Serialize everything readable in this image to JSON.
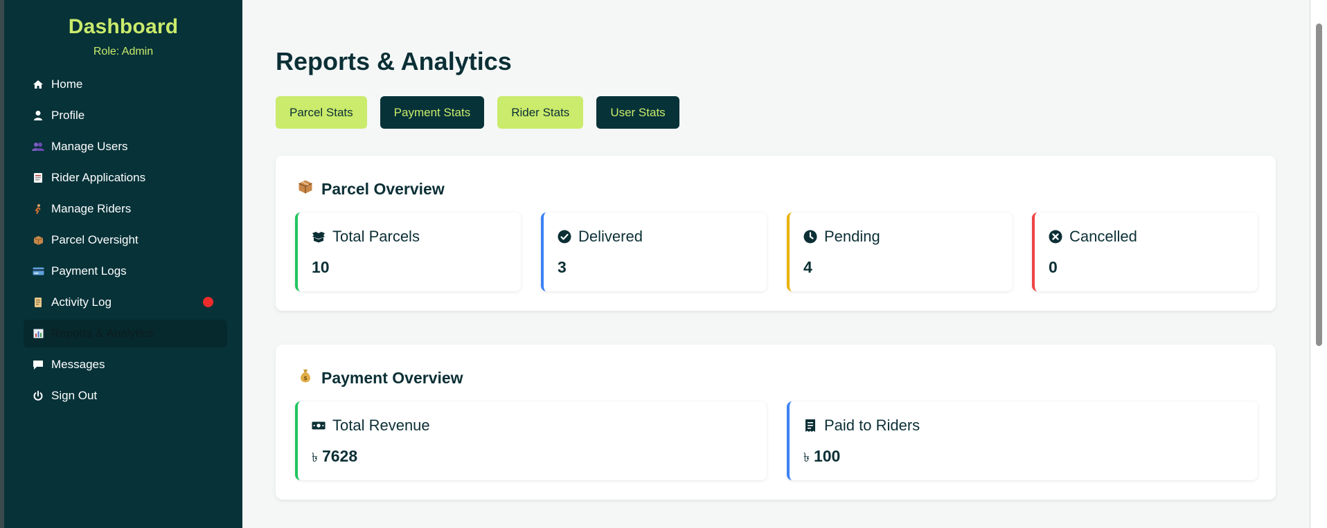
{
  "sidebar": {
    "title": "Dashboard",
    "role": "Role: Admin",
    "items": [
      {
        "label": "Home",
        "icon": "home-icon"
      },
      {
        "label": "Profile",
        "icon": "user-icon"
      },
      {
        "label": "Manage Users",
        "icon": "users-icon"
      },
      {
        "label": "Rider Applications",
        "icon": "document-icon"
      },
      {
        "label": "Manage Riders",
        "icon": "rider-icon"
      },
      {
        "label": "Parcel Oversight",
        "icon": "package-icon"
      },
      {
        "label": "Payment Logs",
        "icon": "credit-card-icon"
      },
      {
        "label": "Activity Log",
        "icon": "scroll-icon"
      },
      {
        "label": "Reports & Analytics",
        "icon": "bar-chart-icon"
      },
      {
        "label": "Messages",
        "icon": "message-icon"
      },
      {
        "label": "Sign Out",
        "icon": "power-icon"
      }
    ],
    "active_item": "Reports & Analytics"
  },
  "main": {
    "title": "Reports & Analytics",
    "tabs": [
      {
        "label": "Parcel Stats",
        "style": "light"
      },
      {
        "label": "Payment Stats",
        "style": "dark"
      },
      {
        "label": "Rider Stats",
        "style": "light"
      },
      {
        "label": "User Stats",
        "style": "dark"
      }
    ],
    "parcel_overview": {
      "title": "Parcel Overview",
      "icon": "package-icon",
      "cards": [
        {
          "label": "Total Parcels",
          "value": "10",
          "icon": "boxes-icon",
          "color": "#22c55e"
        },
        {
          "label": "Delivered",
          "value": "3",
          "icon": "check-circle-icon",
          "color": "#3b82f6"
        },
        {
          "label": "Pending",
          "value": "4",
          "icon": "clock-icon",
          "color": "#eab308"
        },
        {
          "label": "Cancelled",
          "value": "0",
          "icon": "x-circle-icon",
          "color": "#ef4444"
        }
      ]
    },
    "payment_overview": {
      "title": "Payment Overview",
      "icon": "money-bag-icon",
      "currency": "৳",
      "cards": [
        {
          "label": "Total Revenue",
          "value": "7628",
          "icon": "money-bill-icon",
          "color": "#22c55e"
        },
        {
          "label": "Paid to Riders",
          "value": "100",
          "icon": "receipt-icon",
          "color": "#3b82f6"
        }
      ]
    }
  },
  "colors": {
    "sidebar_bg": "#063238",
    "accent_lime": "#caeb6b",
    "text_dark": "#0b2f35",
    "notification_dot": "#ef2b2b"
  }
}
